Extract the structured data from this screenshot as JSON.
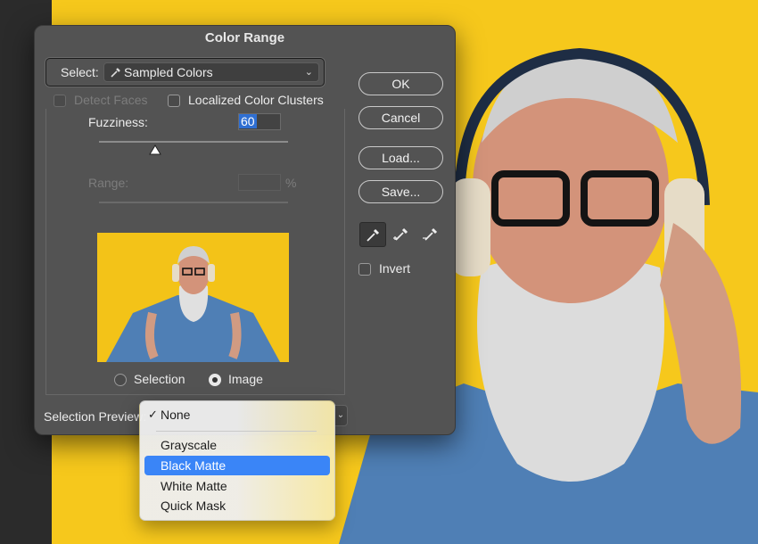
{
  "dialog": {
    "title": "Color Range",
    "select_label": "Select:",
    "select_value": "Sampled Colors",
    "detect_faces": "Detect Faces",
    "localized_clusters": "Localized Color Clusters",
    "fuzziness_label": "Fuzziness:",
    "fuzziness_value": "60",
    "range_label": "Range:",
    "range_unit": "%",
    "radio_selection": "Selection",
    "radio_image": "Image",
    "selection_preview_label": "Selection Preview:",
    "invert_label": "Invert"
  },
  "buttons": {
    "ok": "OK",
    "cancel": "Cancel",
    "load": "Load...",
    "save": "Save..."
  },
  "tools": [
    "eyedropper-icon",
    "eyedropper-plus-icon",
    "eyedropper-minus-icon"
  ],
  "menu": {
    "items": [
      "None",
      "Grayscale",
      "Black Matte",
      "White Matte",
      "Quick Mask"
    ],
    "checked": "None",
    "highlighted": "Black Matte",
    "check_glyph": "✓"
  },
  "colors": {
    "background_yellow": "#f6c81c",
    "dialog_bg": "#535353",
    "accent": "#3a85f7"
  }
}
